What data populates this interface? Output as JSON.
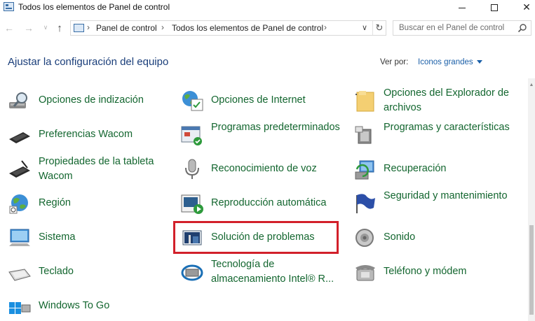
{
  "window": {
    "title": "Todos los elementos de Panel de control",
    "minimize": "",
    "maximize": "",
    "close": "✕"
  },
  "nav": {
    "back": "←",
    "forward": "→",
    "recent": "∨",
    "up": "↑",
    "breadcrumbs": [
      "Panel de control",
      "Todos los elementos de Panel de control"
    ],
    "separator": "›",
    "dropdown": "∨",
    "refresh": "↻",
    "search_placeholder": "Buscar en el Panel de control"
  },
  "header": {
    "title": "Ajustar la configuración del equipo",
    "view_by_label": "Ver por:",
    "view_by_value": "Iconos grandes"
  },
  "items": [
    {
      "label": "Opciones de indización",
      "icon": "indexing-options-icon"
    },
    {
      "label": "Opciones de Internet",
      "icon": "internet-options-icon"
    },
    {
      "label": "Opciones del Explorador de archivos",
      "icon": "file-explorer-options-icon"
    },
    {
      "label": "Preferencias Wacom",
      "icon": "wacom-preferences-icon"
    },
    {
      "label": "Programas predeterminados",
      "icon": "default-programs-icon"
    },
    {
      "label": "Programas y características",
      "icon": "programs-features-icon"
    },
    {
      "label": "Propiedades de la tableta Wacom",
      "icon": "wacom-tablet-icon"
    },
    {
      "label": "Reconocimiento de voz",
      "icon": "speech-recognition-icon"
    },
    {
      "label": "Recuperación",
      "icon": "recovery-icon"
    },
    {
      "label": "Región",
      "icon": "region-icon"
    },
    {
      "label": "Reproducción automática",
      "icon": "autoplay-icon"
    },
    {
      "label": "Seguridad y mantenimiento",
      "icon": "security-maintenance-icon"
    },
    {
      "label": "Sistema",
      "icon": "system-icon"
    },
    {
      "label": "Solución de problemas",
      "icon": "troubleshooting-icon"
    },
    {
      "label": "Sonido",
      "icon": "sound-icon"
    },
    {
      "label": "Teclado",
      "icon": "keyboard-icon"
    },
    {
      "label": "Tecnología de almacenamiento Intel® R...",
      "icon": "intel-storage-icon"
    },
    {
      "label": "Teléfono y módem",
      "icon": "phone-modem-icon"
    },
    {
      "label": "Windows To Go",
      "icon": "windows-to-go-icon"
    }
  ],
  "highlight_color": "#d2202a",
  "link_color": "#13662f"
}
